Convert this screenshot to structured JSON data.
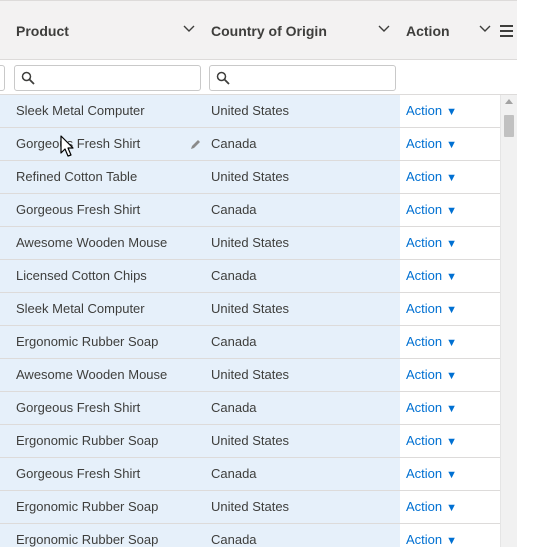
{
  "columns": {
    "product": {
      "label": "Product",
      "menu_icon": "chevron-down-icon"
    },
    "country": {
      "label": "Country of Origin",
      "menu_icon": "chevron-down-icon"
    },
    "action": {
      "label": "Action",
      "menu_icon": "chevron-down-icon"
    }
  },
  "grid_menu_icon": "hamburger-menu-icon",
  "filters": {
    "product": {
      "value": "",
      "placeholder": ""
    },
    "country": {
      "value": "",
      "placeholder": ""
    }
  },
  "action_caret": "▼",
  "rows": [
    {
      "product": "Sleek Metal Computer",
      "country": "United States",
      "action": "Action"
    },
    {
      "product": "Gorgeous Fresh Shirt",
      "country": "Canada",
      "action": "Action"
    },
    {
      "product": "Refined Cotton Table",
      "country": "United States",
      "action": "Action"
    },
    {
      "product": "Gorgeous Fresh Shirt",
      "country": "Canada",
      "action": "Action"
    },
    {
      "product": "Awesome Wooden Mouse",
      "country": "United States",
      "action": "Action"
    },
    {
      "product": "Licensed Cotton Chips",
      "country": "Canada",
      "action": "Action"
    },
    {
      "product": "Sleek Metal Computer",
      "country": "United States",
      "action": "Action"
    },
    {
      "product": "Ergonomic Rubber Soap",
      "country": "Canada",
      "action": "Action"
    },
    {
      "product": "Awesome Wooden Mouse",
      "country": "United States",
      "action": "Action"
    },
    {
      "product": "Gorgeous Fresh Shirt",
      "country": "Canada",
      "action": "Action"
    },
    {
      "product": "Ergonomic Rubber Soap",
      "country": "United States",
      "action": "Action"
    },
    {
      "product": "Gorgeous Fresh Shirt",
      "country": "Canada",
      "action": "Action"
    },
    {
      "product": "Ergonomic Rubber Soap",
      "country": "United States",
      "action": "Action"
    },
    {
      "product": "Ergonomic Rubber Soap",
      "country": "Canada",
      "action": "Action"
    }
  ],
  "colors": {
    "selected_row_bg": "#e6f0fa",
    "link": "#0070d2",
    "header_bg": "#f3f2f2",
    "border": "#dddbda"
  }
}
